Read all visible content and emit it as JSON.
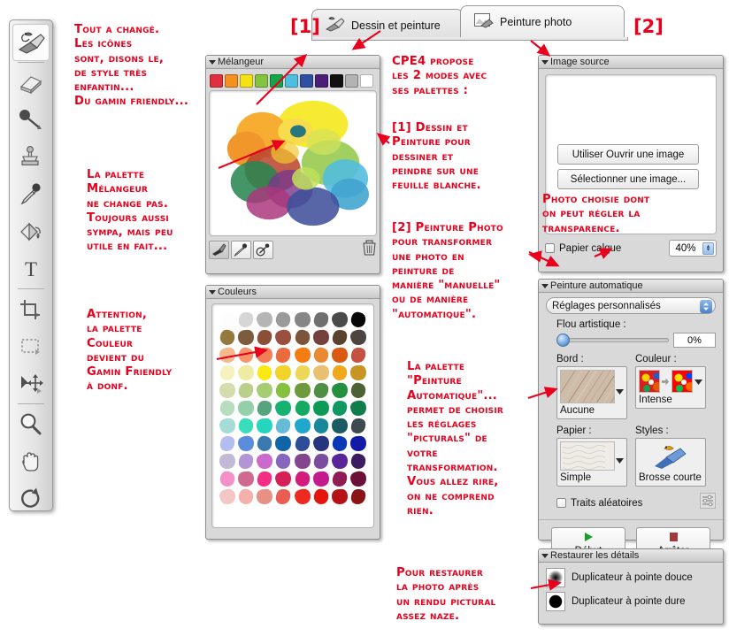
{
  "tabs": [
    {
      "label": "Dessin et peinture",
      "marker": "[1]",
      "icon": "bird-brush-icon",
      "active": false
    },
    {
      "label": "Peinture photo",
      "marker": "[2]",
      "icon": "photo-brush-icon",
      "active": true
    }
  ],
  "toolbar": {
    "tools": [
      {
        "name": "brush-tool",
        "selected": true
      },
      {
        "name": "eraser-tool",
        "selected": false
      },
      {
        "name": "ink-pen-tool",
        "selected": false
      },
      {
        "name": "clone-stamp-tool",
        "selected": false
      },
      {
        "name": "eyedropper-tool",
        "selected": false
      },
      {
        "name": "paint-bucket-tool",
        "selected": false
      },
      {
        "name": "text-tool",
        "selected": false
      },
      {
        "name": "crop-tool",
        "selected": false
      },
      {
        "name": "rectangular-marquee-tool",
        "selected": false
      },
      {
        "name": "move-selection-tool",
        "selected": false
      },
      {
        "name": "zoom-tool",
        "selected": false
      },
      {
        "name": "hand-tool",
        "selected": false
      },
      {
        "name": "rotate-page-tool",
        "selected": false
      }
    ]
  },
  "mixer": {
    "title": "Mélangeur",
    "swatches": [
      "#e0303f",
      "#f39020",
      "#f5e215",
      "#85c441",
      "#15a64c",
      "#4cbfdf",
      "#2f4fa3",
      "#4b1f78",
      "#111111",
      "#b3b3b3",
      "#ffffff"
    ],
    "tools": [
      {
        "name": "mixer-brush-button",
        "selected": true
      },
      {
        "name": "mixer-eyedropper-button",
        "selected": false
      },
      {
        "name": "mixer-sampler-button",
        "selected": false
      }
    ],
    "trash": "mixer-clear-button"
  },
  "colors": {
    "title": "Couleurs",
    "grid": [
      [
        "#fdfdfd",
        "#d6d6d6",
        "#b5b5b5",
        "#9a9a9a",
        "#868686",
        "#6f6f6f",
        "#4a4a4a",
        "#080808"
      ],
      [
        "#94793f",
        "#7d5c3e",
        "#8a4f36",
        "#9b4f3f",
        "#7b543a",
        "#74413c",
        "#59432f",
        "#4c4440"
      ],
      [
        "#f6b98e",
        "#f4966a",
        "#f37d56",
        "#e96b3e",
        "#f57c12",
        "#e98a33",
        "#d95a10",
        "#c45241"
      ],
      [
        "#f6f2c0",
        "#eeeba2",
        "#fbe916",
        "#f2d32a",
        "#eed657",
        "#e8c070",
        "#f0a81d",
        "#c79425"
      ],
      [
        "#d5dcad",
        "#b9cf8b",
        "#a6cc74",
        "#85c03e",
        "#6c9a3d",
        "#4e8f43",
        "#23903f",
        "#4c6235"
      ],
      [
        "#b8dcc0",
        "#92cfaa",
        "#56a47e",
        "#17b171",
        "#16a963",
        "#0d9a56",
        "#119862",
        "#0f7d4c"
      ],
      [
        "#a5dcd5",
        "#38debb",
        "#25d6bd",
        "#66bcd6",
        "#1fa7cd",
        "#18889a",
        "#1b5a63",
        "#3f4a4e"
      ],
      [
        "#b3bdf0",
        "#5a8ddc",
        "#3a7ab0",
        "#1065a8",
        "#2d4e96",
        "#27357f",
        "#0b38b7",
        "#141aa8"
      ],
      [
        "#c0b9d8",
        "#b394d7",
        "#cb69cc",
        "#8766c0",
        "#84468e",
        "#7a4d9e",
        "#59259a",
        "#3b1c63"
      ],
      [
        "#f390c9",
        "#d0698f",
        "#f42e82",
        "#d51f57",
        "#d41a7c",
        "#c41a8e",
        "#8f1c52",
        "#6c0f36"
      ],
      [
        "#f5c7c4",
        "#f5b0ab",
        "#e79085",
        "#eb5c53",
        "#ee2a20",
        "#e4150f",
        "#b51117",
        "#8a1317"
      ]
    ]
  },
  "image_source": {
    "title": "Image source",
    "use_open_button": "Utiliser Ouvrir une image",
    "select_button": "Sélectionner une image...",
    "tracing_paper_label": "Papier calque",
    "tracing_paper_checked": false,
    "opacity_value": "40%"
  },
  "auto_painting": {
    "title": "Peinture automatique",
    "preset": "Réglages personnalisés",
    "blur_label": "Flou artistique :",
    "blur_value": "0%",
    "edge_label": "Bord :",
    "edge_value": "Aucune",
    "color_label": "Couleur :",
    "color_value": "Intense",
    "paper_label": "Papier :",
    "paper_value": "Simple",
    "styles_label": "Styles :",
    "styles_value": "Brosse courte",
    "random_strokes_label": "Traits aléatoires",
    "random_strokes_checked": false,
    "start_button": "Début",
    "stop_button": "Arrêter"
  },
  "restore_details": {
    "title": "Restaurer les détails",
    "items": [
      {
        "label": "Duplicateur à pointe douce",
        "icon": "soft-tip-cloner-icon"
      },
      {
        "label": "Duplicateur à pointe dure",
        "icon": "hard-tip-cloner-icon"
      }
    ]
  },
  "annotations": {
    "toolbar_note": "Tout a changé.\nLes icônes\nsont, disons le,\nde style très\nenfantin...\nDu gamin friendly...",
    "mixer_note": "La palette\nMélangeur\nne change pas.\nToujours aussi\nsympa, mais peu\nutile en fait...",
    "colors_note": "Attention,\nla palette\nCouleur\ndevient du\nGamin Friendly\nà donf.",
    "modes_note": "CPE4 propose\nles 2 modes  avec\nses palettes :",
    "mode1_note": "[1] Dessin et\nPeinture pour\ndessiner et\npeindre sur une\nfeuille blanche.",
    "mode2_note": "[2] Peinture Photo\npour transformer\nune photo en\npeinture de\nmanière \"manuelle\"\nou de manière\n\"automatique\".",
    "source_note": "Photo choisie dont\non peut régler la\ntransparence.",
    "auto_note": "La palette\n\"Peinture\nAutomatique\"...\npermet de choisir\nles réglages\n\"picturals\" de\nvotre\ntransformation.\nVous allez rire,\non ne comprend\nrien.",
    "restore_note": "Pour restaurer\nla photo après\nun rendu pictural\nassez naze."
  },
  "colors_meta": {
    "annotation_red": "#e8001c",
    "panel_gray": "#d9d9d9"
  }
}
